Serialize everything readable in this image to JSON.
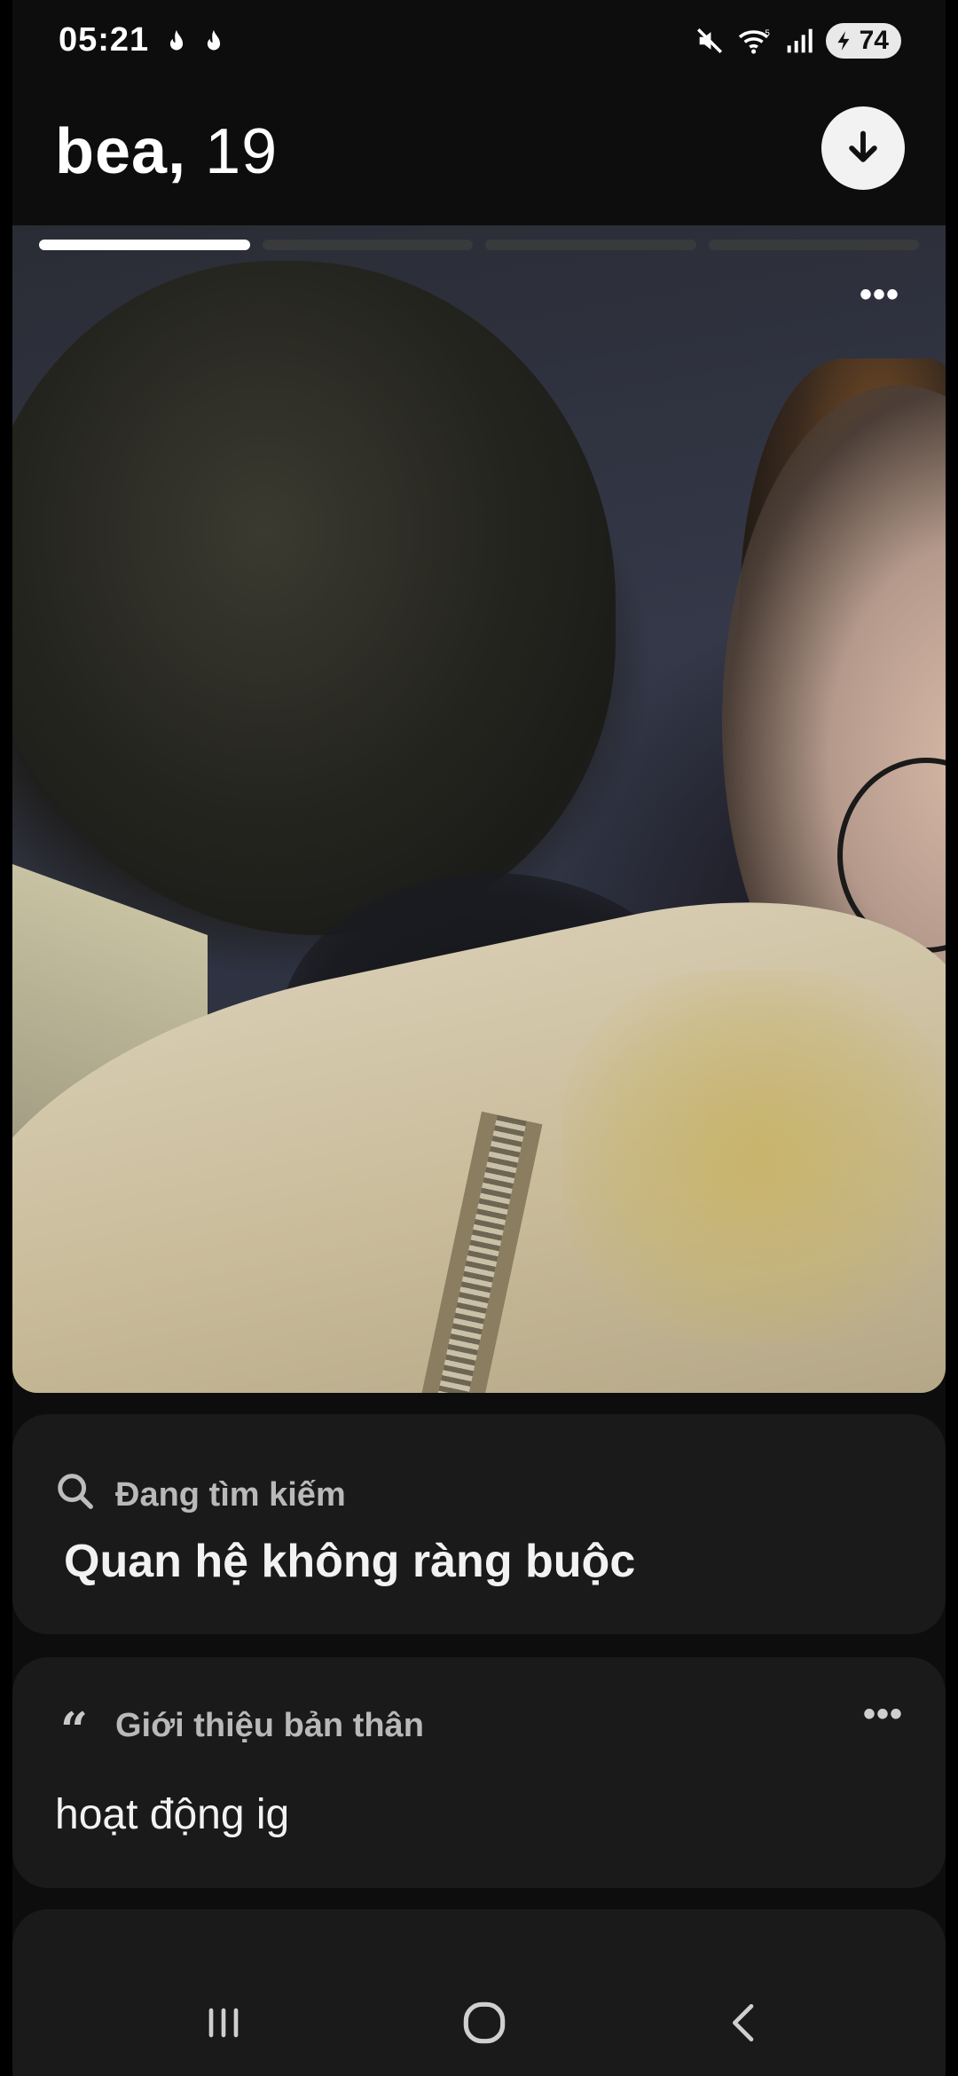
{
  "status_bar": {
    "time": "05:21",
    "battery": "74",
    "icons": [
      "flame-icon",
      "flame-icon",
      "mute-icon",
      "wifi-icon",
      "signal-icon",
      "battery-icon"
    ]
  },
  "header": {
    "name": "bea,",
    "age": "19",
    "download_icon": "arrow-down-icon"
  },
  "photo": {
    "total_photos": 4,
    "active_index": 0,
    "more_label": "•••"
  },
  "looking_for": {
    "label": "Đang tìm kiếm",
    "value": "Quan hệ không ràng buộc",
    "icon": "search-icon"
  },
  "about": {
    "label": "Giới thiệu bản thân",
    "value": "hoạt động ig",
    "quote_glyph": "“",
    "more_label": "•••"
  },
  "navbar": {
    "icons": [
      "recent-apps-icon",
      "home-icon",
      "back-icon"
    ]
  },
  "colors": {
    "background": "#0d0d0d",
    "card": "#1a1a1a",
    "accent_white": "#ffffff",
    "label_gray": "#b9b9b9"
  }
}
